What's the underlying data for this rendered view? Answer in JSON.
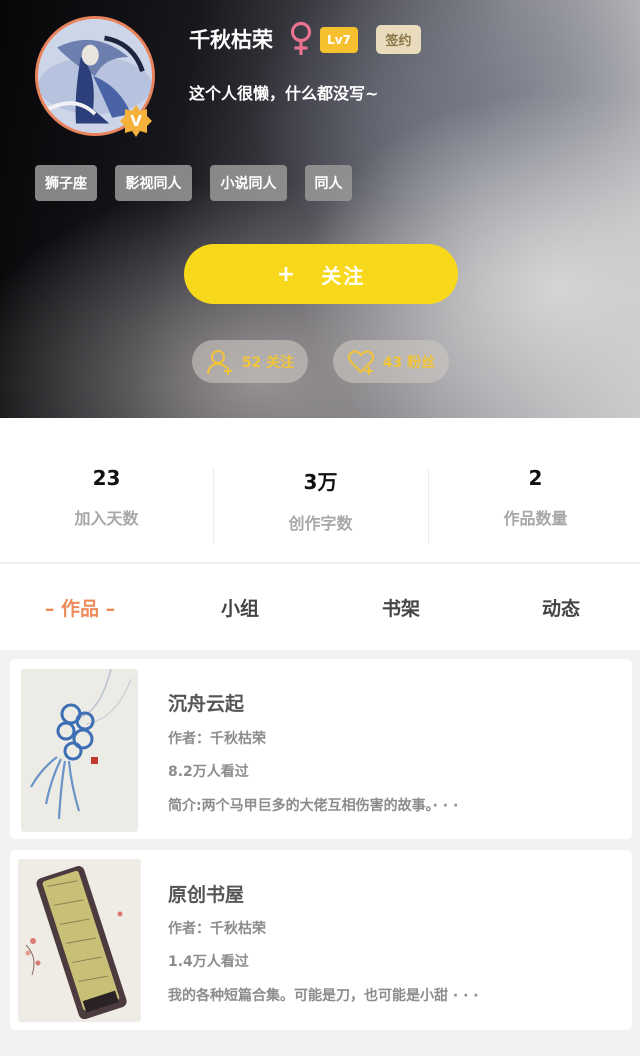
{
  "profile": {
    "username": "千秋枯荣",
    "gender_symbol": "♀",
    "level_badge": "Lv7",
    "sign_badge": "签约",
    "verified_badge": "V",
    "bio": "这个人很懒，什么都没写~",
    "tags": [
      "狮子座",
      "影视同人",
      "小说同人",
      "同人"
    ]
  },
  "follow_button": {
    "icon": "+",
    "label": "关注"
  },
  "social": {
    "following": {
      "icon": "user-plus-icon",
      "label": "52 关注"
    },
    "fans": {
      "icon": "heart-plus-icon",
      "label": "43 粉丝"
    }
  },
  "stats": [
    {
      "value": "23",
      "label": "加入天数"
    },
    {
      "value": "3万",
      "label": "创作字数"
    },
    {
      "value": "2",
      "label": "作品数量"
    }
  ],
  "tabs": [
    {
      "label": "– 作品 –",
      "active": true
    },
    {
      "label": "小组",
      "active": false
    },
    {
      "label": "书架",
      "active": false
    },
    {
      "label": "动态",
      "active": false
    }
  ],
  "works": [
    {
      "title": "沉舟云起",
      "author": "作者：千秋枯荣",
      "views": "8.2万人看过",
      "intro": "简介:两个马甲巨多的大佬互相伤害的故事。· · ·"
    },
    {
      "title": "原创书屋",
      "author": "作者：千秋枯荣",
      "views": "1.4万人看过",
      "intro": "我的各种短篇合集。可能是刀，也可能是小甜 · · ·"
    }
  ],
  "colors": {
    "accent_yellow": "#f8d81b",
    "tab_active": "#ed8b5a",
    "gender_pink": "#e9738f",
    "level_badge": "#f6c02f",
    "pill_text": "#f2c438"
  }
}
